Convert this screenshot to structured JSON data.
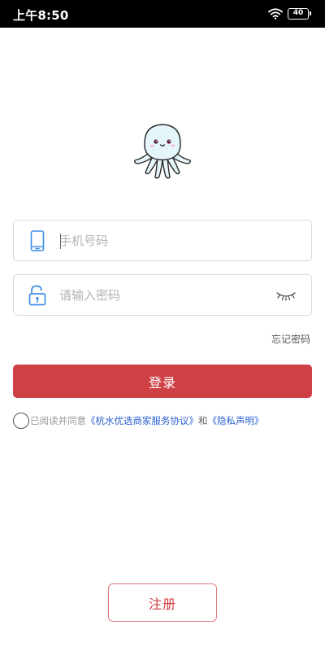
{
  "status_bar": {
    "time": "上午8:50",
    "battery": "40",
    "wifi_icon": "wifi-icon"
  },
  "logo": {
    "icon": "octopus-mascot-icon"
  },
  "phone_field": {
    "icon": "phone-icon",
    "placeholder": "手机号码",
    "value": ""
  },
  "password_field": {
    "icon": "unlock-icon",
    "placeholder": "请输入密码",
    "value": "",
    "toggle_icon": "eye-closed-icon"
  },
  "forgot_password": "忘记密码",
  "login_button": "登录",
  "agreement": {
    "prefix": "已阅读并同意",
    "merchant_link": "《杭水优选商家服务协议》",
    "and": "和",
    "privacy_link": "《隐私声明》",
    "checked": false
  },
  "register_button": "注册",
  "colors": {
    "accent": "#cf4044",
    "link": "#2a5fd0",
    "icon_blue": "#3d8ee8"
  }
}
